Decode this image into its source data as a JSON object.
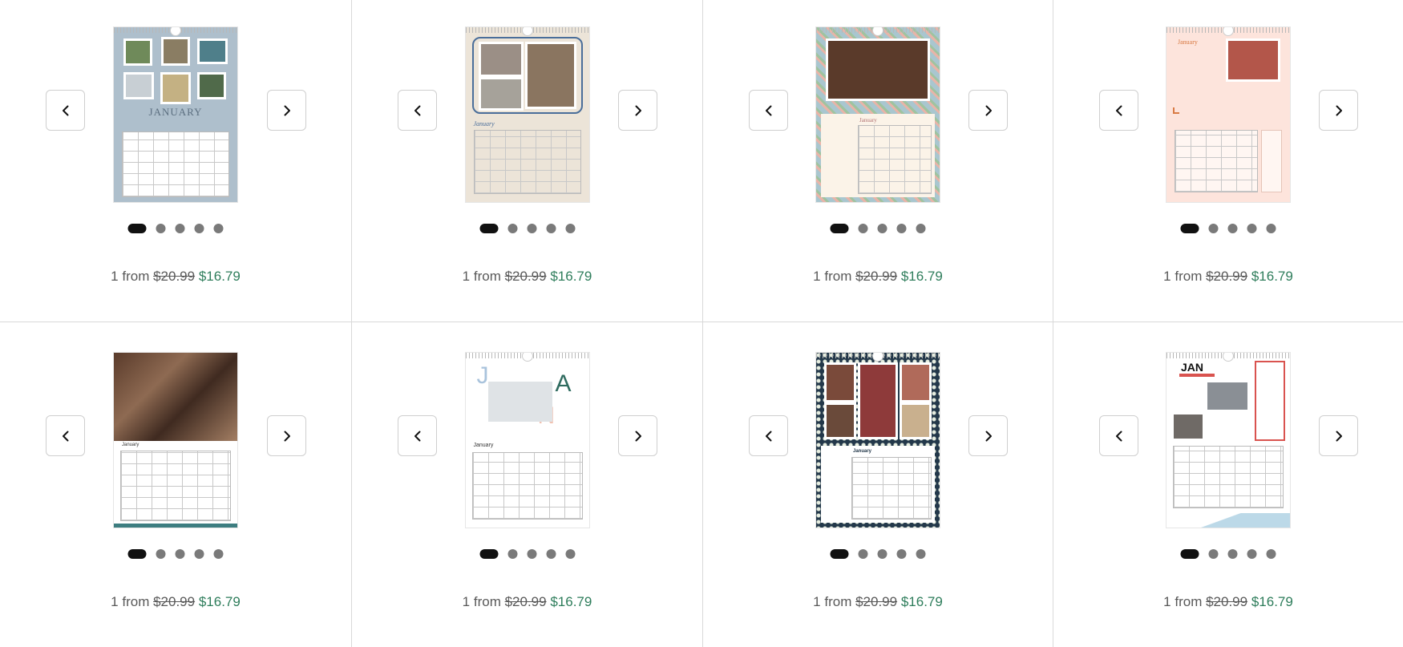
{
  "products": [
    {
      "id": "p1",
      "price": {
        "prefix": "1 from",
        "original": "$20.99",
        "sale": "$16.79"
      },
      "preview_month": "JANUARY",
      "theme": {
        "bg": "#aebfcc",
        "grid_bg": "#ffffff",
        "accent": "#6f8191"
      }
    },
    {
      "id": "p2",
      "price": {
        "prefix": "1 from",
        "original": "$20.99",
        "sale": "$16.79"
      },
      "preview_month": "January",
      "theme": {
        "bg": "#ece4d8",
        "grid_bg": "#ece4d8",
        "accent": "#4a6e9a"
      }
    },
    {
      "id": "p3",
      "price": {
        "prefix": "1 from",
        "original": "$20.99",
        "sale": "$16.79"
      },
      "preview_month": "January",
      "theme": {
        "bg": "#a9c6cf",
        "grid_bg": "#fbf3e8",
        "accent": "#d98a8a"
      }
    },
    {
      "id": "p4",
      "price": {
        "prefix": "1 from",
        "original": "$20.99",
        "sale": "$16.79"
      },
      "preview_month": "January",
      "theme": {
        "bg": "#fde4dc",
        "grid_bg": "#fff6f2",
        "accent": "#d97b45"
      }
    },
    {
      "id": "p5",
      "price": {
        "prefix": "1 from",
        "original": "$20.99",
        "sale": "$16.79"
      },
      "preview_month": "January",
      "theme": {
        "bg": "#ffffff",
        "grid_bg": "#ffffff",
        "accent": "#3d7d80"
      }
    },
    {
      "id": "p6",
      "price": {
        "prefix": "1 from",
        "original": "$20.99",
        "sale": "$16.79"
      },
      "preview_month": "January",
      "theme": {
        "bg": "#ffffff",
        "grid_bg": "#ffffff",
        "accent": "#2f6b5f"
      }
    },
    {
      "id": "p7",
      "price": {
        "prefix": "1 from",
        "original": "$20.99",
        "sale": "$16.79"
      },
      "preview_month": "January",
      "theme": {
        "bg": "#23384a",
        "grid_bg": "#ffffff",
        "accent": "#e7eee0"
      }
    },
    {
      "id": "p8",
      "price": {
        "prefix": "1 from",
        "original": "$20.99",
        "sale": "$16.79"
      },
      "preview_month": "JAN",
      "theme": {
        "bg": "#ffffff",
        "grid_bg": "#ffffff",
        "accent": "#d9534f"
      }
    }
  ],
  "carousel": {
    "dot_count": 5,
    "active_dot": 1
  },
  "icons": {
    "prev": "chevron-left-icon",
    "next": "chevron-right-icon"
  },
  "colors": {
    "sale_price": "#2e7d5b",
    "divider": "#d9d9d9",
    "active_dot": "#111111",
    "dot": "#7a7a7a"
  }
}
